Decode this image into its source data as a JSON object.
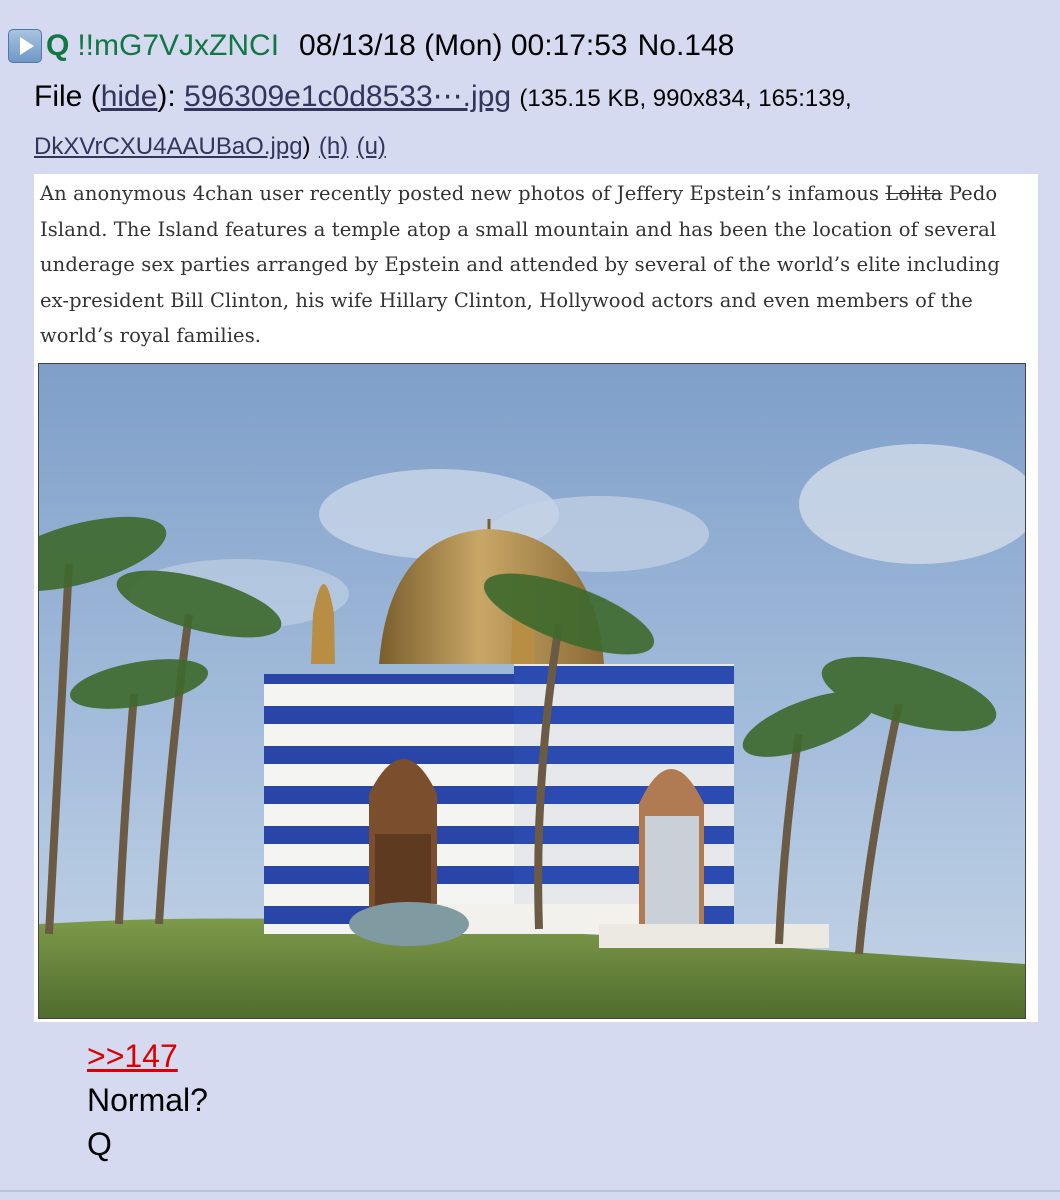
{
  "post": {
    "name": "Q",
    "tripcode": "!!mG7VJxZNCI",
    "date": "08/13/18 (Mon) 00:17:53",
    "number": "No.148",
    "play_icon": "play-icon"
  },
  "file": {
    "label": "File",
    "hide_open": "(",
    "hide_label": "hide",
    "hide_close": "):",
    "filename": "596309e1c0d8533⋯.jpg",
    "meta": "(135.15 KB, 990x834, 165:139,",
    "original_name": "DkXVrCXU4AAUBaO.jpg",
    "paren_close": ")",
    "h_link": "(h)",
    "u_link": "(u)"
  },
  "attachment": {
    "caption_part1": "An anonymous 4chan user recently posted new photos of Jeffery Epstein’s infamous ",
    "caption_struck": "Lolita",
    "caption_part2": " Pedo Island. The Island features a temple atop a small mountain and has been the location of several underage sex parties arranged by Epstein and attended by several of the world’s elite including ex-president Bill Clinton, his wife Hillary Clinton, Hollywood actors and even members of the world’s royal families."
  },
  "message": {
    "quote": ">>147",
    "line1": "Normal?",
    "line2": "Q"
  },
  "colors": {
    "background": "#d6daf0",
    "name_green": "#117743",
    "link": "#34345c",
    "quote_red": "#dd0000"
  }
}
